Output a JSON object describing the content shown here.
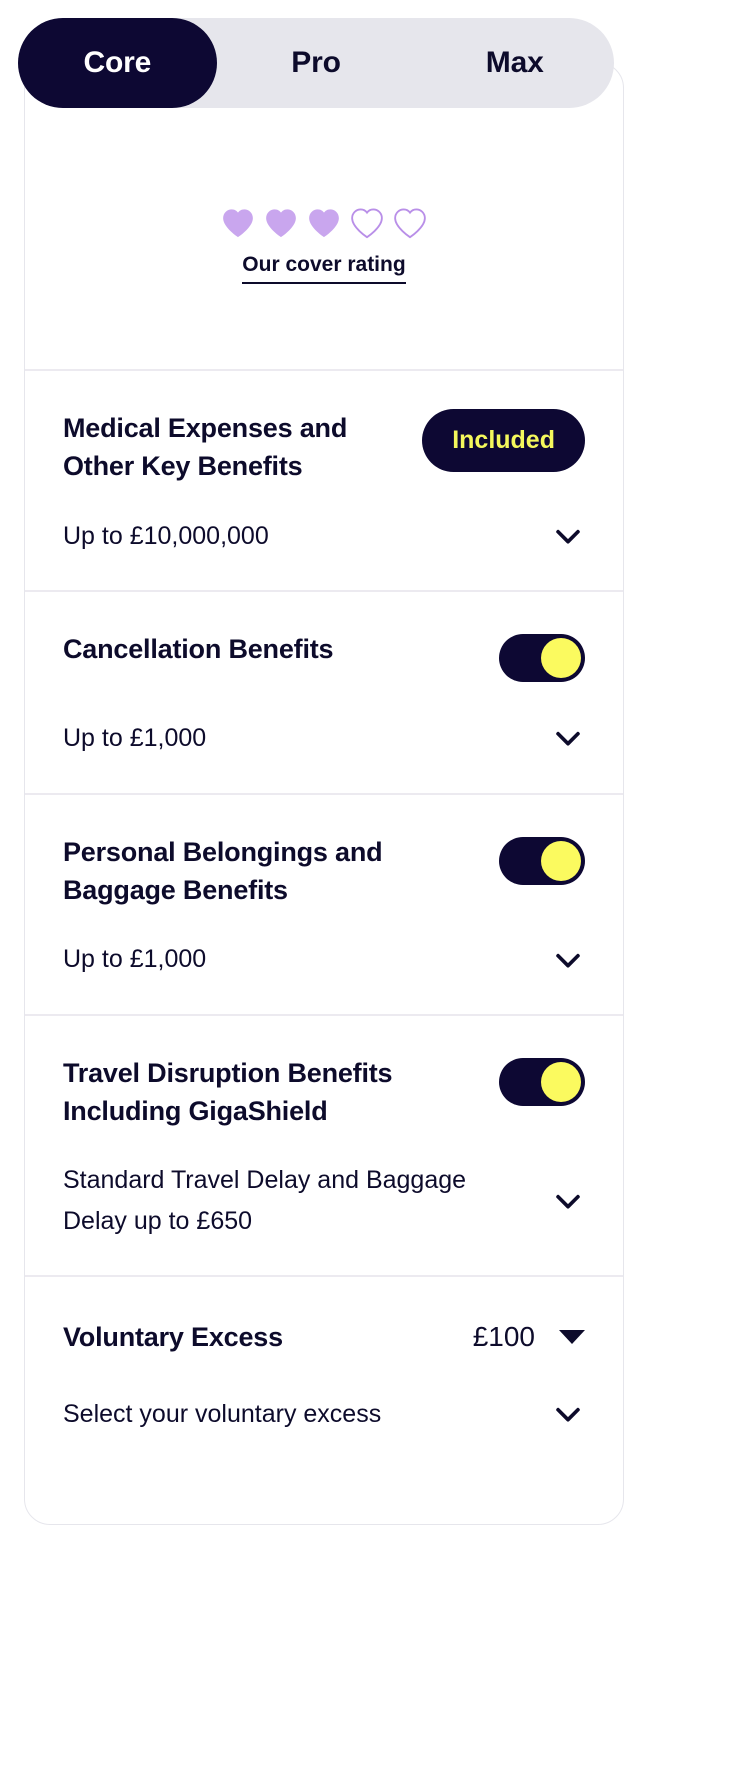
{
  "tabs": [
    {
      "label": "Core",
      "active": true
    },
    {
      "label": "Pro",
      "active": false
    },
    {
      "label": "Max",
      "active": false
    }
  ],
  "rating": {
    "label": "Our cover rating",
    "filled": 3,
    "total": 5,
    "filled_color": "#c9a6ee",
    "outline_color": "#b98fe8"
  },
  "benefits": [
    {
      "title": "Medical Expenses and Other Key Benefits",
      "subtitle": "Up to £10,000,000",
      "control": "badge",
      "badge_label": "Included",
      "expand_icon": "chevron-down-icon"
    },
    {
      "title": "Cancellation Benefits",
      "subtitle": "Up to £1,000",
      "control": "toggle",
      "toggle_on": true,
      "expand_icon": "chevron-down-icon"
    },
    {
      "title": "Personal Belongings and Baggage Benefits",
      "subtitle": "Up to £1,000",
      "control": "toggle",
      "toggle_on": true,
      "expand_icon": "chevron-down-icon"
    },
    {
      "title": "Travel Disruption Benefits Including GigaShield",
      "subtitle": "Standard Travel Delay and Baggage Delay up to £650",
      "control": "toggle",
      "toggle_on": true,
      "expand_icon": "chevron-down-icon"
    }
  ],
  "excess": {
    "title": "Voluntary Excess",
    "value": "£100",
    "select_label": "Select your voluntary excess",
    "caret_icon": "caret-down-icon",
    "expand_icon": "chevron-down-icon"
  },
  "colors": {
    "navy": "#0d0833",
    "yellow": "#fbfa5f",
    "lilac": "#c9a6ee",
    "tab_track": "#e6e6ec",
    "divider": "#eceaf0"
  }
}
